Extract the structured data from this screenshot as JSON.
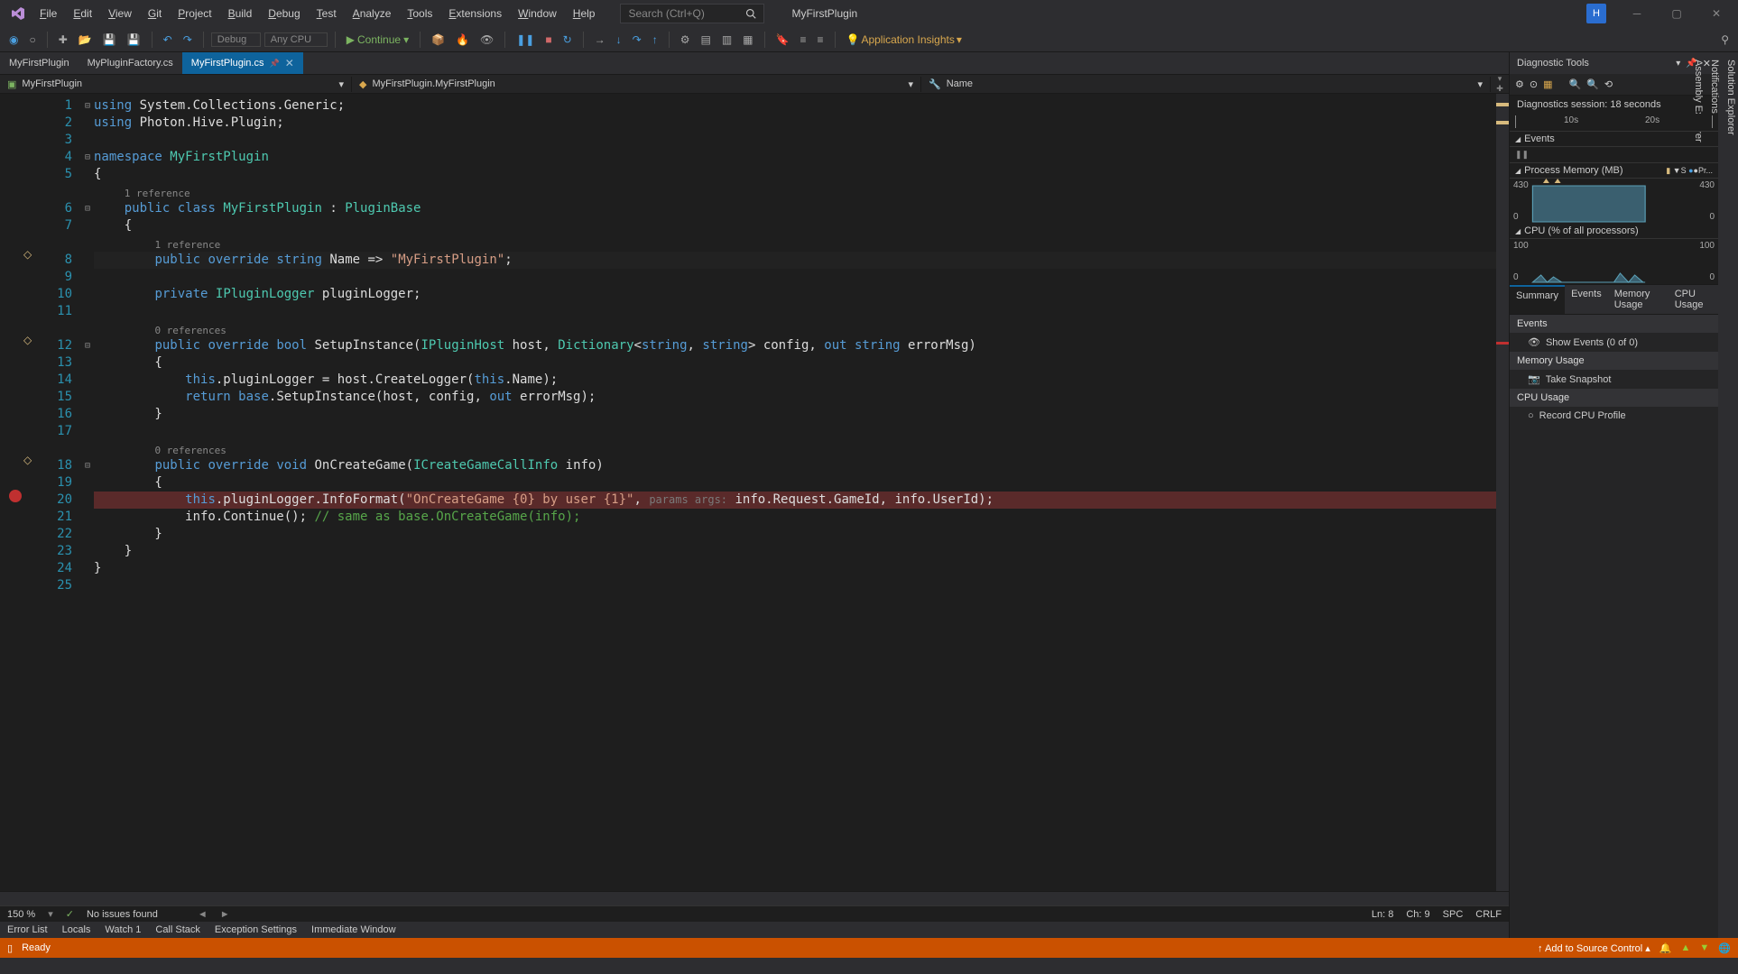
{
  "titleBar": {
    "menu": [
      "File",
      "Edit",
      "View",
      "Git",
      "Project",
      "Build",
      "Debug",
      "Test",
      "Analyze",
      "Tools",
      "Extensions",
      "Window",
      "Help"
    ],
    "searchPlaceholder": "Search (Ctrl+Q)",
    "solutionName": "MyFirstPlugin",
    "avatarInitial": "H"
  },
  "toolbar": {
    "configDropdown": "Debug",
    "platformDropdown": "Any CPU",
    "continueLabel": "Continue",
    "insightsLabel": "Application Insights"
  },
  "docTabs": [
    {
      "label": "MyFirstPlugin",
      "active": false,
      "pinned": false
    },
    {
      "label": "MyPluginFactory.cs",
      "active": false,
      "pinned": false
    },
    {
      "label": "MyFirstPlugin.cs",
      "active": true,
      "pinned": true
    }
  ],
  "navBar": {
    "project": "MyFirstPlugin",
    "class": "MyFirstPlugin.MyFirstPlugin",
    "member": "Name"
  },
  "sideTabs": [
    "Solution Explorer",
    "Notifications",
    "Assembly Explorer"
  ],
  "codeLines": [
    {
      "n": 1,
      "fold": "⊟",
      "html": "<span class='kw'>using</span> System.Collections.Generic;"
    },
    {
      "n": 2,
      "fold": "",
      "html": "<span class='kw'>using</span> Photon.Hive.Plugin;"
    },
    {
      "n": 3,
      "fold": "",
      "html": ""
    },
    {
      "n": 4,
      "fold": "⊟",
      "html": "<span class='kw'>namespace</span> <span class='type'>MyFirstPlugin</span>"
    },
    {
      "n": 5,
      "fold": "",
      "html": "{"
    },
    {
      "n": 0,
      "fold": "",
      "html": "    <span class='ref'>1 reference</span>"
    },
    {
      "n": 6,
      "fold": "⊟",
      "html": "    <span class='kw'>public</span> <span class='kw'>class</span> <span class='type'>MyFirstPlugin</span> : <span class='type'>PluginBase</span>"
    },
    {
      "n": 7,
      "fold": "",
      "html": "    {"
    },
    {
      "n": 0,
      "fold": "",
      "html": "        <span class='ref'>1 reference</span>"
    },
    {
      "n": 8,
      "fold": "",
      "html": "        <span class='kw'>public</span> <span class='kw'>override</span> <span class='kw'>string</span> Name =&gt; <span class='str'>\"MyFirstPlugin\"</span>;",
      "bulb": true,
      "cursor": true
    },
    {
      "n": 9,
      "fold": "",
      "html": ""
    },
    {
      "n": 10,
      "fold": "",
      "html": "        <span class='kw'>private</span> <span class='type'>IPluginLogger</span> pluginLogger;"
    },
    {
      "n": 11,
      "fold": "",
      "html": ""
    },
    {
      "n": 0,
      "fold": "",
      "html": "        <span class='ref'>0 references</span>"
    },
    {
      "n": 12,
      "fold": "⊟",
      "html": "        <span class='kw'>public</span> <span class='kw'>override</span> <span class='kw'>bool</span> SetupInstance(<span class='type'>IPluginHost</span> host, <span class='type'>Dictionary</span>&lt;<span class='kw'>string</span>, <span class='kw'>string</span>&gt; config, <span class='kw'>out</span> <span class='kw'>string</span> errorMsg)",
      "bulb": true
    },
    {
      "n": 13,
      "fold": "",
      "html": "        {"
    },
    {
      "n": 14,
      "fold": "",
      "html": "            <span class='kw'>this</span>.pluginLogger = host.CreateLogger(<span class='kw'>this</span>.Name);"
    },
    {
      "n": 15,
      "fold": "",
      "html": "            <span class='kw'>return</span> <span class='kw'>base</span>.SetupInstance(host, config, <span class='kw'>out</span> errorMsg);"
    },
    {
      "n": 16,
      "fold": "",
      "html": "        }"
    },
    {
      "n": 17,
      "fold": "",
      "html": ""
    },
    {
      "n": 0,
      "fold": "",
      "html": "        <span class='ref'>0 references</span>"
    },
    {
      "n": 18,
      "fold": "⊟",
      "html": "        <span class='kw'>public</span> <span class='kw'>override</span> <span class='kw'>void</span> OnCreateGame(<span class='type'>ICreateGameCallInfo</span> info)",
      "bulb": true
    },
    {
      "n": 19,
      "fold": "",
      "html": "        {"
    },
    {
      "n": 20,
      "fold": "",
      "html": "            <span class='kw'>this</span>.pluginLogger.InfoFormat(<span class='str'>\"OnCreateGame {0} by user {1}\"</span>, <span class='hint'>params args:</span> info.Request.GameId, info.UserId);",
      "bp": true
    },
    {
      "n": 21,
      "fold": "",
      "html": "            info.Continue(); <span class='cmt'>// same as base.OnCreateGame(info);</span>"
    },
    {
      "n": 22,
      "fold": "",
      "html": "        }"
    },
    {
      "n": 23,
      "fold": "",
      "html": "    }"
    },
    {
      "n": 24,
      "fold": "",
      "html": "}"
    },
    {
      "n": 25,
      "fold": "",
      "html": ""
    }
  ],
  "editorStatus": {
    "zoom": "150 %",
    "issues": "No issues found",
    "line": "Ln: 8",
    "col": "Ch: 9",
    "spaces": "SPC",
    "lineEnding": "CRLF"
  },
  "bottomTabs": [
    "Error List",
    "Locals",
    "Watch 1",
    "Call Stack",
    "Exception Settings",
    "Immediate Window"
  ],
  "statusBar": {
    "ready": "Ready",
    "addSourceControl": "Add to Source Control"
  },
  "diag": {
    "title": "Diagnostic Tools",
    "session": "Diagnostics session: 18 seconds",
    "ticks": [
      "10s",
      "20s"
    ],
    "events": "Events",
    "processMemory": "Process Memory (MB)",
    "memBadges": [
      "▼S",
      "●Pr..."
    ],
    "memMax": "430",
    "memMin": "0",
    "cpu": "CPU (% of all processors)",
    "cpuMax": "100",
    "cpuMin": "0",
    "tabs": [
      "Summary",
      "Events",
      "Memory Usage",
      "CPU Usage"
    ],
    "sections": {
      "events": "Events",
      "showEvents": "Show Events (0 of 0)",
      "memUsage": "Memory Usage",
      "snapshot": "Take Snapshot",
      "cpuUsage": "CPU Usage",
      "record": "Record CPU Profile"
    }
  }
}
